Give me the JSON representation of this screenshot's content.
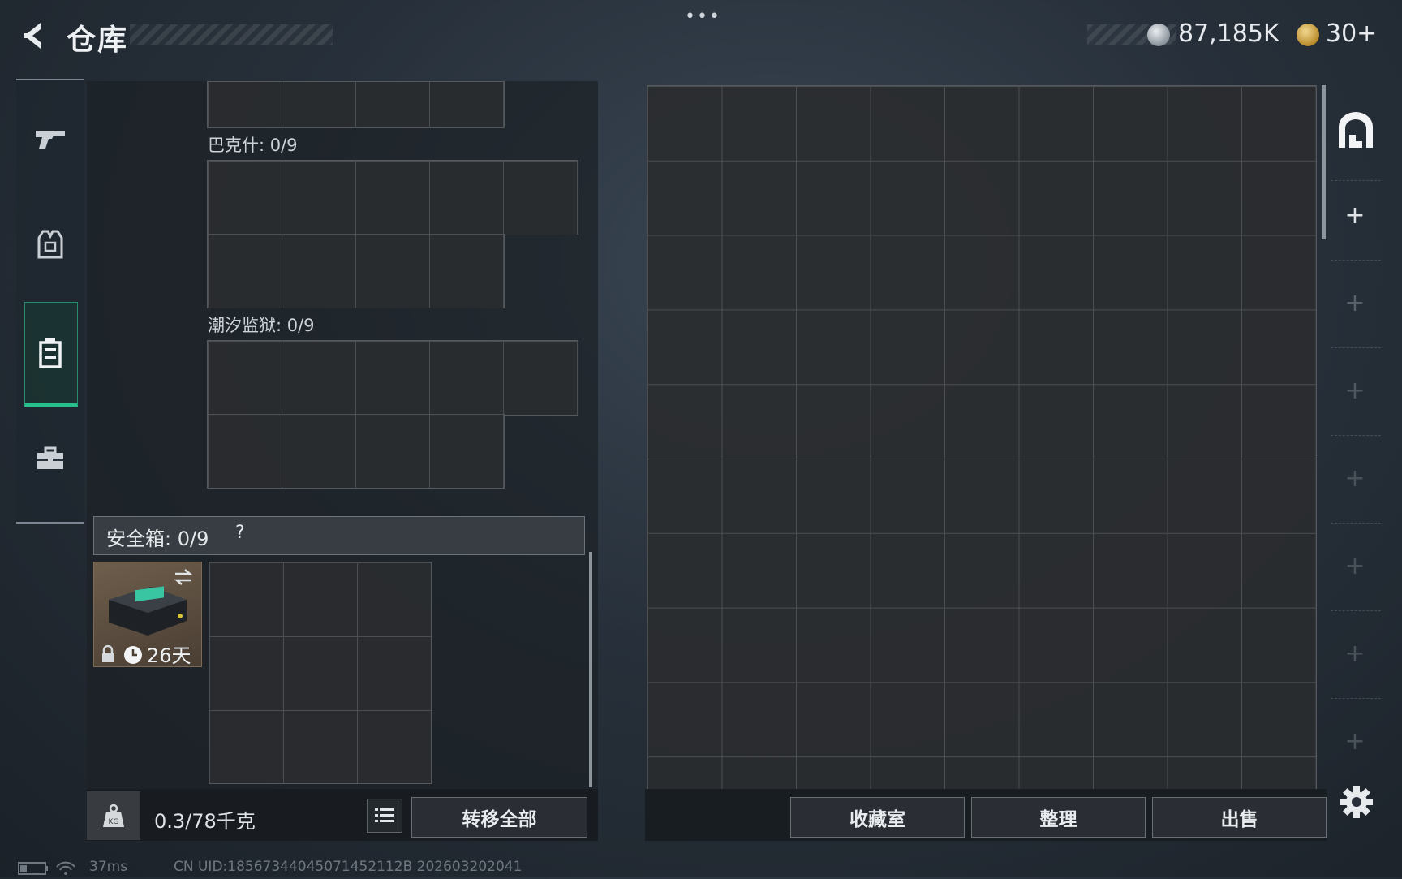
{
  "header": {
    "title": "仓库",
    "menu_dots": "•••",
    "currency": [
      {
        "icon": "silver-coin-icon",
        "value": "87,185K"
      },
      {
        "icon": "gold-coin-icon",
        "value": "30+"
      }
    ]
  },
  "sidebar": {
    "items": [
      {
        "name": "weapon",
        "icon": "pistol-icon",
        "active": false
      },
      {
        "name": "equipment",
        "icon": "vest-icon",
        "active": false
      },
      {
        "name": "backpack",
        "icon": "backpack-icon",
        "active": true
      },
      {
        "name": "toolbox",
        "icon": "toolbox-icon",
        "active": false
      }
    ],
    "active_color": "#27c08a"
  },
  "left_panel": {
    "sections": [
      {
        "label": "巴克什: 0/9"
      },
      {
        "label": "潮汐监狱: 0/9"
      }
    ],
    "safe_box": {
      "label": "安全箱:  0/9",
      "help": "?",
      "days": "26天"
    },
    "weight": "0.3/78千克",
    "transfer_all": "转移全部"
  },
  "right_panel": {
    "buttons": {
      "collection": "收藏室",
      "sort": "整理",
      "sell": "出售"
    }
  },
  "status": {
    "ping": "37ms",
    "uid": "CN UID:18567344045071452112B 202603202041"
  }
}
